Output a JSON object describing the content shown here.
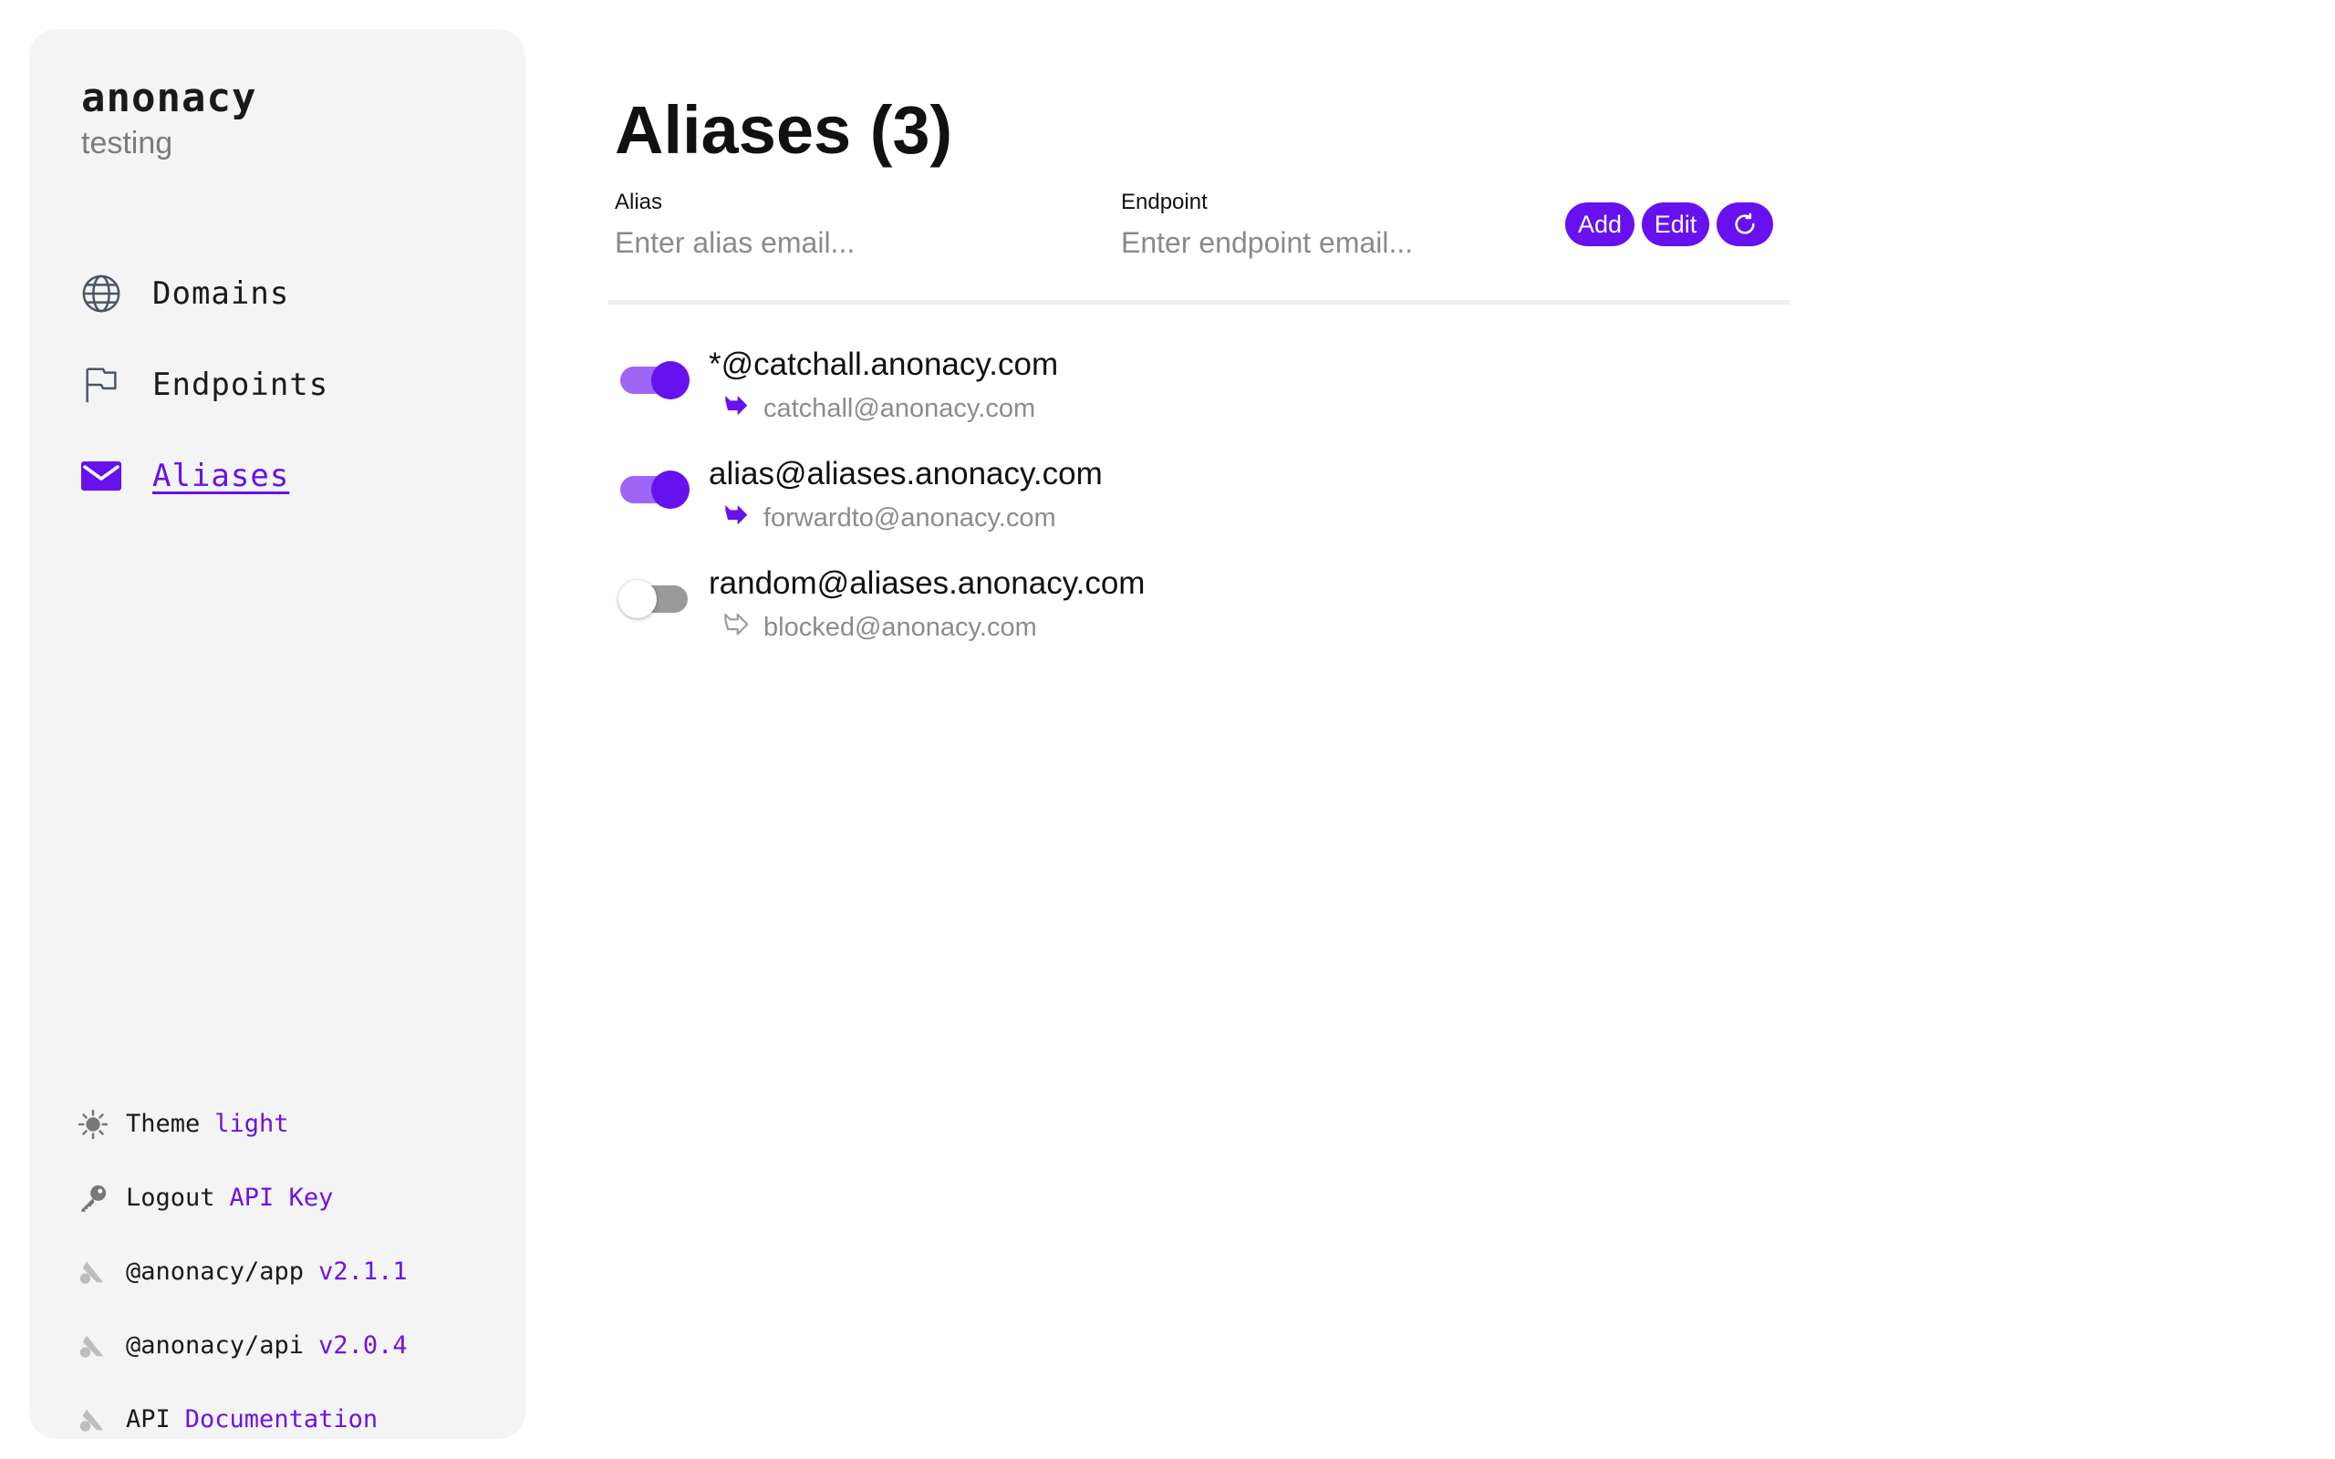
{
  "sidebar": {
    "brand": "anonacy",
    "subtitle": "testing",
    "nav": [
      {
        "label": "Domains",
        "icon": "globe-icon",
        "active": false
      },
      {
        "label": "Endpoints",
        "icon": "flag-icon",
        "active": false
      },
      {
        "label": "Aliases",
        "icon": "mail-icon",
        "active": true
      }
    ],
    "footer": {
      "theme": {
        "label": "Theme",
        "value": "light",
        "icon": "sun-icon"
      },
      "logout": {
        "label": "Logout",
        "value": "API Key",
        "icon": "key-icon"
      },
      "app": {
        "label": "@anonacy/app",
        "value": "v2.1.1",
        "icon": "anonacy-logo-icon"
      },
      "api": {
        "label": "@anonacy/api",
        "value": "v2.0.4",
        "icon": "anonacy-logo-icon"
      },
      "docs": {
        "label": "API",
        "value": "Documentation",
        "icon": "anonacy-logo-icon"
      }
    }
  },
  "main": {
    "title": "Aliases (3)",
    "form": {
      "alias_label": "Alias",
      "alias_placeholder": "Enter alias email...",
      "endpoint_label": "Endpoint",
      "endpoint_placeholder": "Enter endpoint email...",
      "add_label": "Add",
      "edit_label": "Edit",
      "refresh_icon": "refresh-icon"
    },
    "aliases": [
      {
        "alias": "*@catchall.anonacy.com",
        "endpoint": "catchall@anonacy.com",
        "enabled": true
      },
      {
        "alias": "alias@aliases.anonacy.com",
        "endpoint": "forwardto@anonacy.com",
        "enabled": true
      },
      {
        "alias": "random@aliases.anonacy.com",
        "endpoint": "blocked@anonacy.com",
        "enabled": false
      }
    ]
  },
  "colors": {
    "accent": "#6611ee",
    "toggle_track_on": "#9f66f6",
    "toggle_track_off": "#9a9a9a",
    "sidebar_bg": "#f4f4f5",
    "muted_text": "#8c8c8c"
  }
}
